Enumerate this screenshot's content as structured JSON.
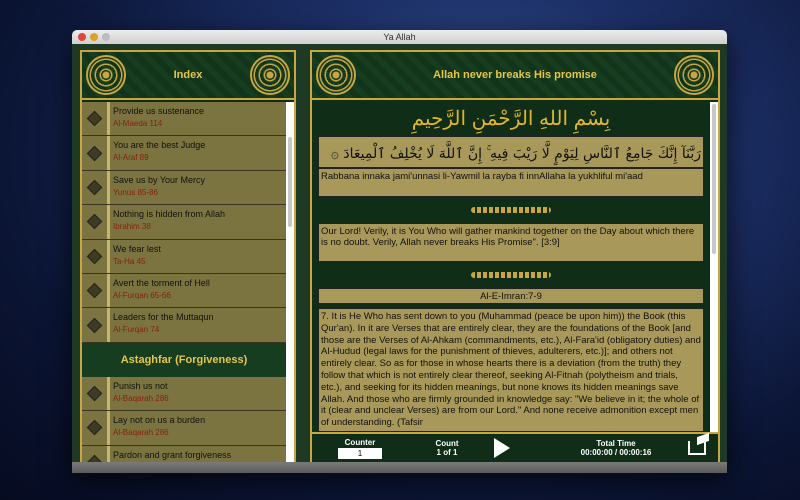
{
  "window": {
    "title": "Ya Allah"
  },
  "index": {
    "title": "Index",
    "items": [
      {
        "title": "Provide us sustenance",
        "ref": "Al-Maeda 114"
      },
      {
        "title": "You are the best Judge",
        "ref": "Al-Araf 89"
      },
      {
        "title": "Save us by Your Mercy",
        "ref": "Yunus 85-86"
      },
      {
        "title": "Nothing is hidden from Allah",
        "ref": "Ibrahim 38"
      },
      {
        "title": "We fear lest",
        "ref": "Ta-Ha 45"
      },
      {
        "title": "Avert the torment of Hell",
        "ref": "Al-Furqan 65-66"
      },
      {
        "title": "Leaders for the Muttaqun",
        "ref": "Al-Furqan 74"
      }
    ],
    "section": "Astaghfar (Forgiveness)",
    "items2": [
      {
        "title": "Punish us not",
        "ref": "Al-Baqarah 286"
      },
      {
        "title": "Lay not on us a burden",
        "ref": "Al-Baqarah 286"
      },
      {
        "title": "Pardon and grant forgiveness",
        "ref": ""
      }
    ]
  },
  "detail": {
    "title": "Allah never breaks His promise",
    "bismillah": "بِسْمِ اللهِ الرَّحْمَنِ الرَّحِيمِ",
    "arabic": "رَبَّنَآ إِنَّكَ جَامِعُ ٱلنَّاسِ لِيَوْمٍ لَّا رَيْبَ فِيهِ ۚ إِنَّ ٱللَّهَ لَا يُخْلِفُ ٱلْمِيعَادَ ۞",
    "transliteration": "Rabbana innaka jami'unnasi li-Yawmil la rayba fi innAllaha la yukhliful mi'aad",
    "translation": "Our Lord! Verily, it is You Who will gather mankind together on the Day about which there is no doubt. Verily, Allah never breaks His Promise\". [3:9]",
    "reference": "Al-E-Imran:7-9",
    "tafsir": "7. It is He Who has sent down to you (Muhammad (peace be upon him)) the Book (this Qur'an). In it are Verses that are entirely clear, they are the foundations of the Book [and those are the Verses of Al-Ahkam (commandments, etc.), Al-Fara'id (obligatory duties) and Al-Hudud (legal laws for the punishment of thieves, adulterers, etc.)]; and others not entirely clear. So as for those in whose hearts there is a deviation (from the truth) they follow that which is not entirely clear thereof, seeking Al-Fitnah (polytheism and trials, etc.), and seeking for its hidden meanings, but none knows its hidden meanings save Allah. And those who are firmly grounded in knowledge say: \"We believe in it; the whole of it (clear and unclear Verses) are from our Lord.\" And none receive admonition except men of understanding. (Tafsir"
  },
  "player": {
    "counter_label": "Counter",
    "counter_value": "1",
    "count_label": "Count",
    "count_value": "1 of 1",
    "time_label": "Total Time",
    "time_value": "00:00:00 / 00:00:16"
  }
}
